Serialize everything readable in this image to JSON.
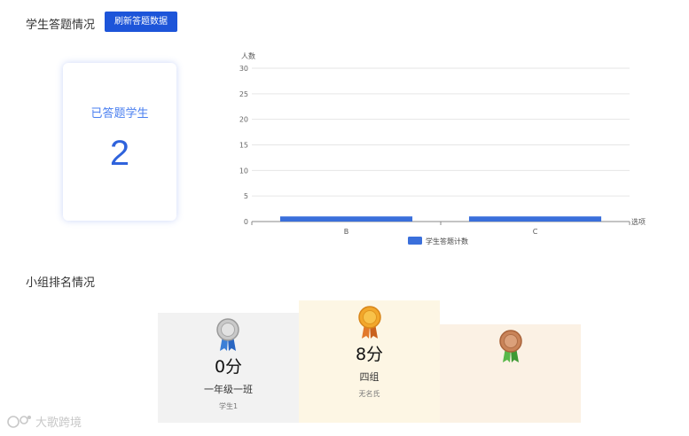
{
  "header": {
    "title": "学生答题情况",
    "refresh_label": "刷新答题数据"
  },
  "stat_card": {
    "label": "已答题学生",
    "value": "2"
  },
  "chart_data": {
    "type": "bar",
    "categories": [
      "B",
      "C"
    ],
    "series": [
      {
        "name": "学生答题计数",
        "values": [
          1,
          1
        ]
      }
    ],
    "ylabel": "人数",
    "xlabel": "选项",
    "ylim": [
      0,
      30
    ],
    "yticks": [
      0,
      5,
      10,
      15,
      20,
      25,
      30
    ],
    "grid": true,
    "legend_position": "bottom",
    "bar_color": "#3a6fdb"
  },
  "ranking": {
    "title": "小组排名情况",
    "podium": [
      {
        "rank": 2,
        "medal": "silver",
        "score": "0分",
        "group": "一年级一班",
        "member": "学生1",
        "bg": "#f2f2f2"
      },
      {
        "rank": 1,
        "medal": "gold",
        "score": "8分",
        "group": "四组",
        "member": "无名氏",
        "bg": "#fdf6e4"
      },
      {
        "rank": 3,
        "medal": "bronze",
        "score": "",
        "group": "",
        "member": "",
        "bg": "#fbf1e4"
      }
    ]
  },
  "watermark": {
    "text": "大歌跨境"
  }
}
